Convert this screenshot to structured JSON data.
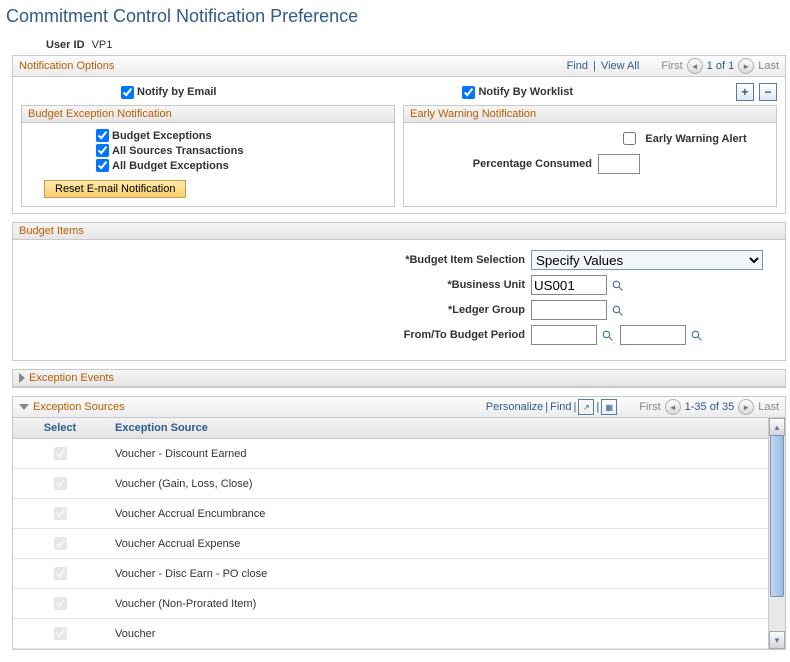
{
  "page_title": "Commitment Control Notification Preference",
  "user_id_label": "User ID",
  "user_id_value": "VP1",
  "notification_options": {
    "title": "Notification Options",
    "find": "Find",
    "view_all": "View All",
    "nav_first": "First",
    "nav_last": "Last",
    "nav_count": "1 of 1",
    "notify_email_label": "Notify by Email",
    "notify_worklist_label": "Notify By Worklist",
    "notify_email_checked": true,
    "notify_worklist_checked": true
  },
  "budget_exception": {
    "title": "Budget Exception Notification",
    "items": [
      {
        "label": "Budget Exceptions",
        "checked": true
      },
      {
        "label": "All Sources Transactions",
        "checked": true
      },
      {
        "label": "All Budget Exceptions",
        "checked": true
      }
    ],
    "reset_label": "Reset E-mail Notification"
  },
  "early_warning": {
    "title": "Early Warning Notification",
    "alert_label": "Early Warning Alert",
    "alert_checked": false,
    "percent_label": "Percentage Consumed",
    "percent_value": ""
  },
  "budget_items": {
    "title": "Budget Items",
    "selection_label": "*Budget Item Selection",
    "selection_value": "Specify Values",
    "bu_label": "*Business Unit",
    "bu_value": "US001",
    "lg_label": "*Ledger Group",
    "lg_value": "",
    "period_label": "From/To Budget Period",
    "period_from": "",
    "period_to": ""
  },
  "exception_events_title": "Exception Events",
  "exception_sources": {
    "title": "Exception Sources",
    "personalize": "Personalize",
    "find": "Find",
    "nav_first": "First",
    "nav_last": "Last",
    "nav_count": "1-35 of 35",
    "col_select": "Select",
    "col_source": "Exception Source",
    "rows": [
      "Voucher - Discount Earned",
      "Voucher (Gain, Loss, Close)",
      "Voucher Accrual Encumbrance",
      "Voucher Accrual Expense",
      "Voucher - Disc Earn - PO close",
      "Voucher (Non-Prorated Item)",
      "Voucher"
    ]
  }
}
